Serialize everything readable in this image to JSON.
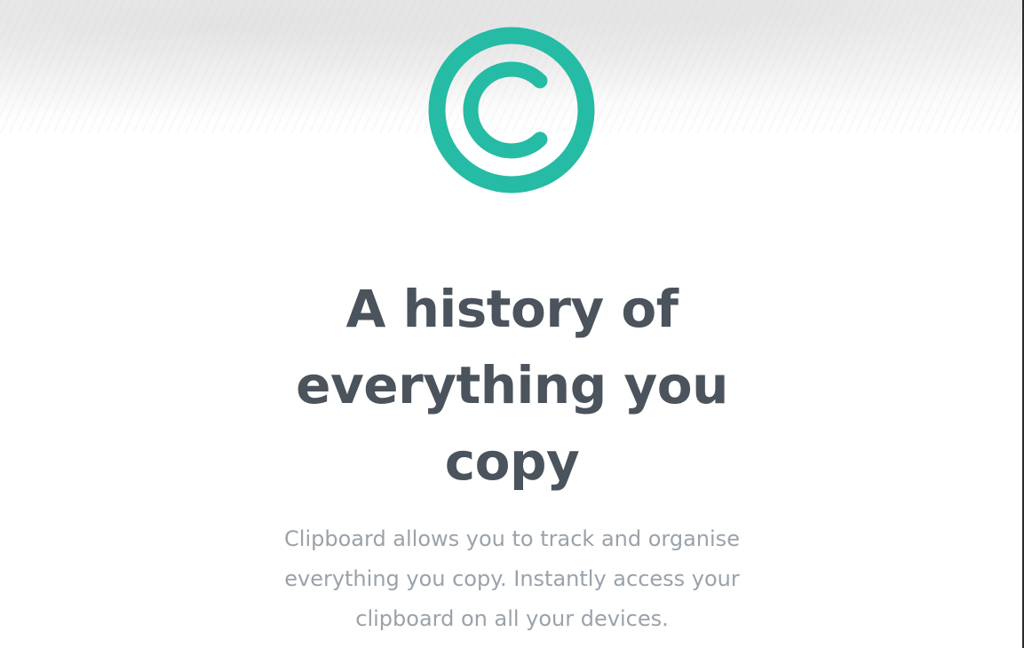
{
  "hero": {
    "logo_icon": "copyright-c-icon",
    "headline": "A history of everything you copy",
    "description": "Clipboard allows you to track and organise everything you copy. Instantly access your clipboard on all your devices."
  },
  "colors": {
    "brand": "#26bba4",
    "heading": "#4b535c",
    "body_text": "#9aa2aa"
  }
}
